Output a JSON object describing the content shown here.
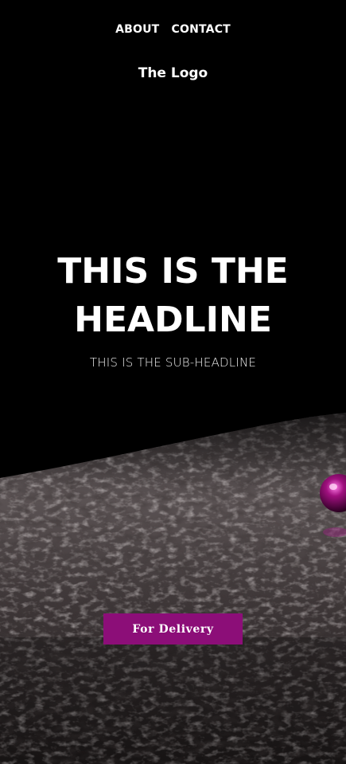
{
  "nav": {
    "items": [
      {
        "label": "ABOUT"
      },
      {
        "label": "CONTACT"
      }
    ]
  },
  "logo": {
    "text": "The Logo"
  },
  "hero": {
    "headline_line1": "THIS IS THE",
    "headline_line2": "HEADLINE",
    "subheadline": "THIS IS THE SUB-HEADLINE",
    "cta_label": "For Delivery"
  },
  "colors": {
    "background": "#000000",
    "accent": "#8c0e78",
    "text": "#ffffff"
  },
  "background_image": {
    "subject": "dark granite countertop with purple sphere"
  }
}
